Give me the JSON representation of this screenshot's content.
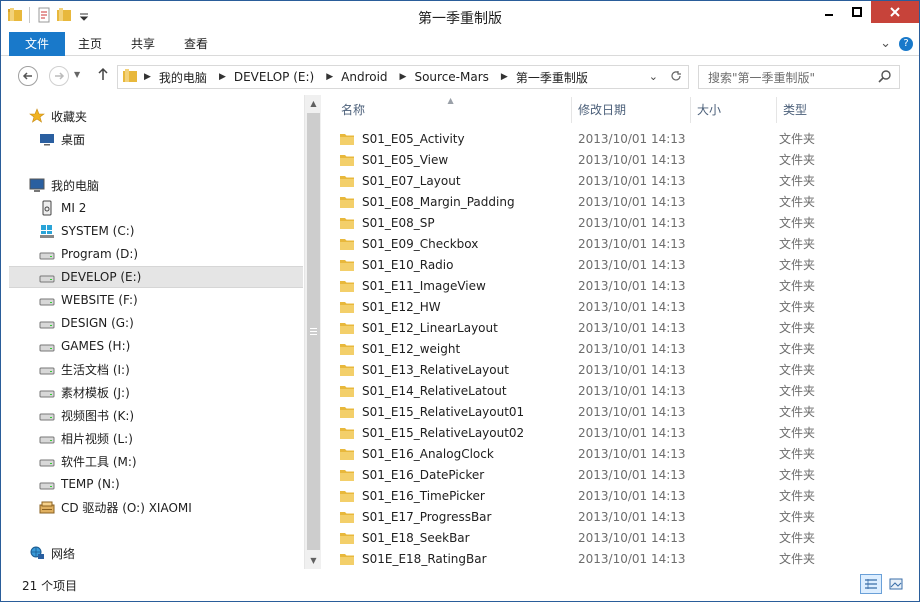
{
  "window": {
    "title": "第一季重制版",
    "controls": {
      "minimize": "▁",
      "maximize": "□",
      "close": "✕"
    }
  },
  "ribbon": {
    "tabs": [
      "文件",
      "主页",
      "共享",
      "查看"
    ],
    "expand_label": "⌄",
    "help_label": "?"
  },
  "address_bar": {
    "breadcrumbs": [
      "我的电脑",
      "DEVELOP (E:)",
      "Android",
      "Source-Mars",
      "第一季重制版"
    ],
    "search_placeholder": "搜索\"第一季重制版\""
  },
  "nav_pane": {
    "favorites": {
      "label": "收藏夹",
      "items": [
        "桌面"
      ]
    },
    "computer": {
      "label": "我的电脑",
      "items": [
        {
          "label": "MI 2",
          "icon": "phone-icon"
        },
        {
          "label": "SYSTEM (C:)",
          "icon": "windows-drive-icon"
        },
        {
          "label": "Program (D:)",
          "icon": "drive-icon"
        },
        {
          "label": "DEVELOP (E:)",
          "icon": "drive-icon",
          "selected": true
        },
        {
          "label": "WEBSITE (F:)",
          "icon": "drive-icon"
        },
        {
          "label": "DESIGN (G:)",
          "icon": "drive-icon"
        },
        {
          "label": "GAMES (H:)",
          "icon": "drive-icon"
        },
        {
          "label": "生活文档 (I:)",
          "icon": "drive-icon"
        },
        {
          "label": "素材模板 (J:)",
          "icon": "drive-icon"
        },
        {
          "label": "视频图书 (K:)",
          "icon": "drive-icon"
        },
        {
          "label": "相片视频 (L:)",
          "icon": "drive-icon"
        },
        {
          "label": "软件工具 (M:)",
          "icon": "drive-icon"
        },
        {
          "label": "TEMP (N:)",
          "icon": "drive-icon"
        },
        {
          "label": "CD 驱动器 (O:) XIAOMI",
          "icon": "cd-drive-icon"
        }
      ]
    },
    "network": {
      "label": "网络"
    }
  },
  "file_list": {
    "columns": [
      "名称",
      "修改日期",
      "大小",
      "类型"
    ],
    "rows": [
      {
        "name": "S01_E05_Activity",
        "date": "2013/10/01 14:13",
        "type": "文件夹"
      },
      {
        "name": "S01_E05_View",
        "date": "2013/10/01 14:13",
        "type": "文件夹"
      },
      {
        "name": "S01_E07_Layout",
        "date": "2013/10/01 14:13",
        "type": "文件夹"
      },
      {
        "name": "S01_E08_Margin_Padding",
        "date": "2013/10/01 14:13",
        "type": "文件夹"
      },
      {
        "name": "S01_E08_SP",
        "date": "2013/10/01 14:13",
        "type": "文件夹"
      },
      {
        "name": "S01_E09_Checkbox",
        "date": "2013/10/01 14:13",
        "type": "文件夹"
      },
      {
        "name": "S01_E10_Radio",
        "date": "2013/10/01 14:13",
        "type": "文件夹"
      },
      {
        "name": "S01_E11_ImageView",
        "date": "2013/10/01 14:13",
        "type": "文件夹"
      },
      {
        "name": "S01_E12_HW",
        "date": "2013/10/01 14:13",
        "type": "文件夹"
      },
      {
        "name": "S01_E12_LinearLayout",
        "date": "2013/10/01 14:13",
        "type": "文件夹"
      },
      {
        "name": "S01_E12_weight",
        "date": "2013/10/01 14:13",
        "type": "文件夹"
      },
      {
        "name": "S01_E13_RelativeLayout",
        "date": "2013/10/01 14:13",
        "type": "文件夹"
      },
      {
        "name": "S01_E14_RelativeLatout",
        "date": "2013/10/01 14:13",
        "type": "文件夹"
      },
      {
        "name": "S01_E15_RelativeLayout01",
        "date": "2013/10/01 14:13",
        "type": "文件夹"
      },
      {
        "name": "S01_E15_RelativeLayout02",
        "date": "2013/10/01 14:13",
        "type": "文件夹"
      },
      {
        "name": "S01_E16_AnalogClock",
        "date": "2013/10/01 14:13",
        "type": "文件夹"
      },
      {
        "name": "S01_E16_DatePicker",
        "date": "2013/10/01 14:13",
        "type": "文件夹"
      },
      {
        "name": "S01_E16_TimePicker",
        "date": "2013/10/01 14:13",
        "type": "文件夹"
      },
      {
        "name": "S01_E17_ProgressBar",
        "date": "2013/10/01 14:13",
        "type": "文件夹"
      },
      {
        "name": "S01_E18_SeekBar",
        "date": "2013/10/01 14:13",
        "type": "文件夹"
      },
      {
        "name": "S01E_E18_RatingBar",
        "date": "2013/10/01 14:13",
        "type": "文件夹"
      }
    ]
  },
  "status_bar": {
    "item_count": "21 个项目"
  },
  "colors": {
    "accent": "#1979ca",
    "close": "#c7433a",
    "folder": "#e8b83c"
  }
}
